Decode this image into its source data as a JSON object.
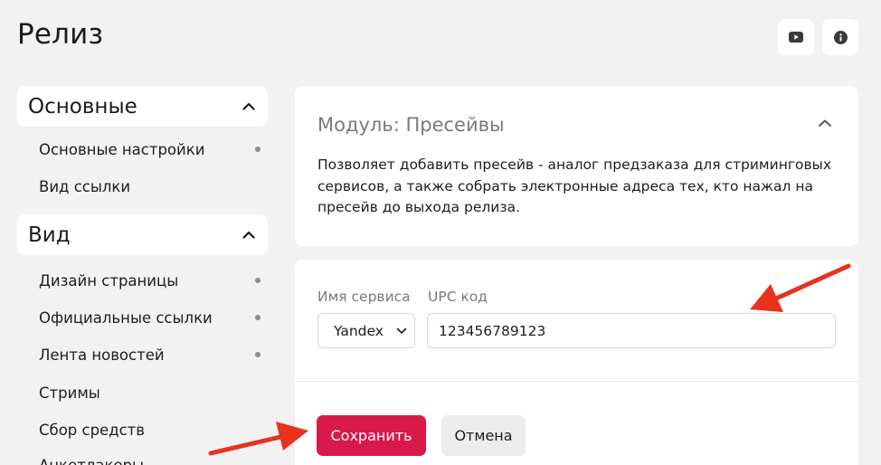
{
  "page": {
    "title": "Релиз"
  },
  "toolbar": {
    "youtube_icon": "youtube-icon",
    "info_icon": "info-icon"
  },
  "sidebar": {
    "groups": [
      {
        "label": "Основные",
        "expanded": true,
        "items": [
          {
            "label": "Основные настройки",
            "dot": true
          },
          {
            "label": "Вид ссылки",
            "dot": false
          }
        ]
      },
      {
        "label": "Вид",
        "expanded": true,
        "items": [
          {
            "label": "Дизайн страницы",
            "dot": true
          },
          {
            "label": "Официальные ссылки",
            "dot": true
          },
          {
            "label": "Лента новостей",
            "dot": true
          },
          {
            "label": "Стримы",
            "dot": false
          },
          {
            "label": "Сбор средств",
            "dot": false
          },
          {
            "label": "Анкетлакеры",
            "dot": false
          }
        ]
      }
    ]
  },
  "module": {
    "title": "Модуль: Пресейвы",
    "description": "Позволяет добавить пресейв - аналог предзаказа для стриминговых сервисов, а также собрать электронные адреса тех, кто нажал на пресейв до выхода релиза."
  },
  "form": {
    "service_label": "Имя сервиса",
    "service_value": "Yandex",
    "upc_label": "UPC код",
    "upc_value": "123456789123",
    "save_label": "Сохранить",
    "cancel_label": "Отмена"
  },
  "colors": {
    "accent": "#d9194a",
    "annotation_arrow": "#e8321e",
    "background": "#f2f2f2"
  }
}
